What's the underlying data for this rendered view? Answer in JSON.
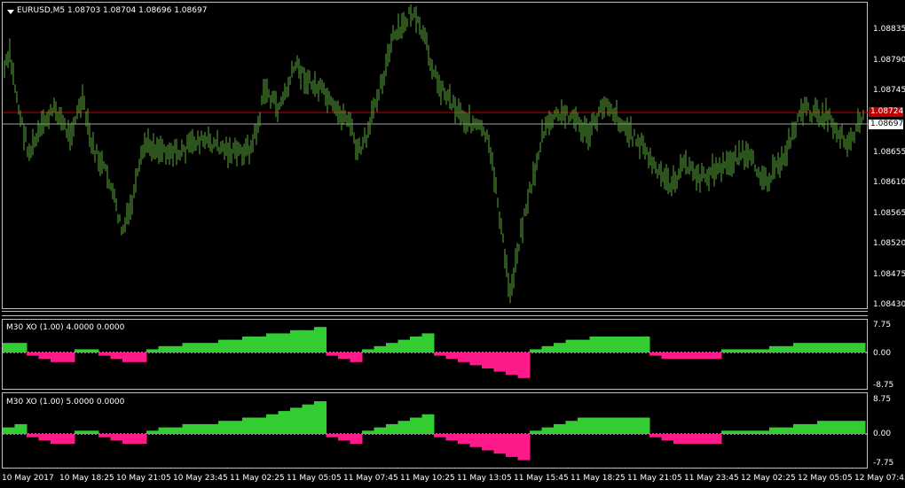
{
  "main": {
    "title": "EURUSD,M5  1.08703 1.08704 1.08696 1.08697",
    "price_axis": [
      "1.08835",
      "1.08790",
      "1.08745",
      "1.08610",
      "1.08565",
      "1.08520",
      "1.08475",
      "1.08430",
      "1.08655"
    ],
    "current_price": "1.08697",
    "line_price": "1.08724",
    "colors": {
      "candle": "#5aa83a",
      "line_red": "#c00000",
      "line_grey": "#a0a0a0",
      "tag_red": "#c00000"
    }
  },
  "ind1": {
    "title": "M30 XO (1.00) 4.0000 0.0000",
    "axis": [
      "7.75",
      "0.00",
      "-8.75"
    ]
  },
  "ind2": {
    "title": "M30 XO (1.00) 5.0000 0.0000",
    "axis": [
      "8.75",
      "0.00",
      "-7.75"
    ]
  },
  "time_axis": [
    "10 May 2017",
    "10 May 18:25",
    "10 May 21:05",
    "10 May 23:45",
    "11 May 02:25",
    "11 May 05:05",
    "11 May 07:45",
    "11 May 10:25",
    "11 May 13:05",
    "11 May 15:45",
    "11 May 18:25",
    "11 May 21:05",
    "11 May 23:45",
    "12 May 02:25",
    "12 May 05:05",
    "12 May 07:45"
  ],
  "chart_data": {
    "type": "bar",
    "series": [
      {
        "values": [
          3,
          3,
          -1,
          -2,
          -3,
          -3,
          1,
          1,
          -1,
          -2,
          -3,
          -3,
          1,
          2,
          2,
          3,
          3,
          3,
          4,
          4,
          5,
          5,
          6,
          6,
          7,
          7,
          8,
          -1,
          -2,
          -3,
          1,
          2,
          3,
          4,
          5,
          6,
          -1,
          -2,
          -3,
          -4,
          -5,
          -6,
          -7,
          -8,
          1,
          2,
          3,
          4,
          4,
          5,
          5,
          5,
          5,
          5,
          -1,
          -2,
          -2,
          -2,
          -2,
          -2,
          1,
          1,
          1,
          1,
          2,
          2,
          3,
          3,
          3,
          3,
          3,
          3
        ]
      },
      {
        "values": [
          2,
          3,
          -1,
          -2,
          -3,
          -3,
          1,
          1,
          -1,
          -2,
          -3,
          -3,
          1,
          2,
          2,
          3,
          3,
          3,
          4,
          4,
          5,
          5,
          6,
          7,
          8,
          9,
          10,
          -1,
          -2,
          -3,
          1,
          2,
          3,
          4,
          5,
          6,
          -1,
          -2,
          -3,
          -4,
          -5,
          -6,
          -7,
          -8,
          1,
          2,
          3,
          4,
          5,
          5,
          5,
          5,
          5,
          5,
          -1,
          -2,
          -3,
          -3,
          -3,
          -3,
          1,
          1,
          1,
          1,
          2,
          2,
          3,
          3,
          4,
          4,
          4,
          4
        ]
      }
    ]
  }
}
